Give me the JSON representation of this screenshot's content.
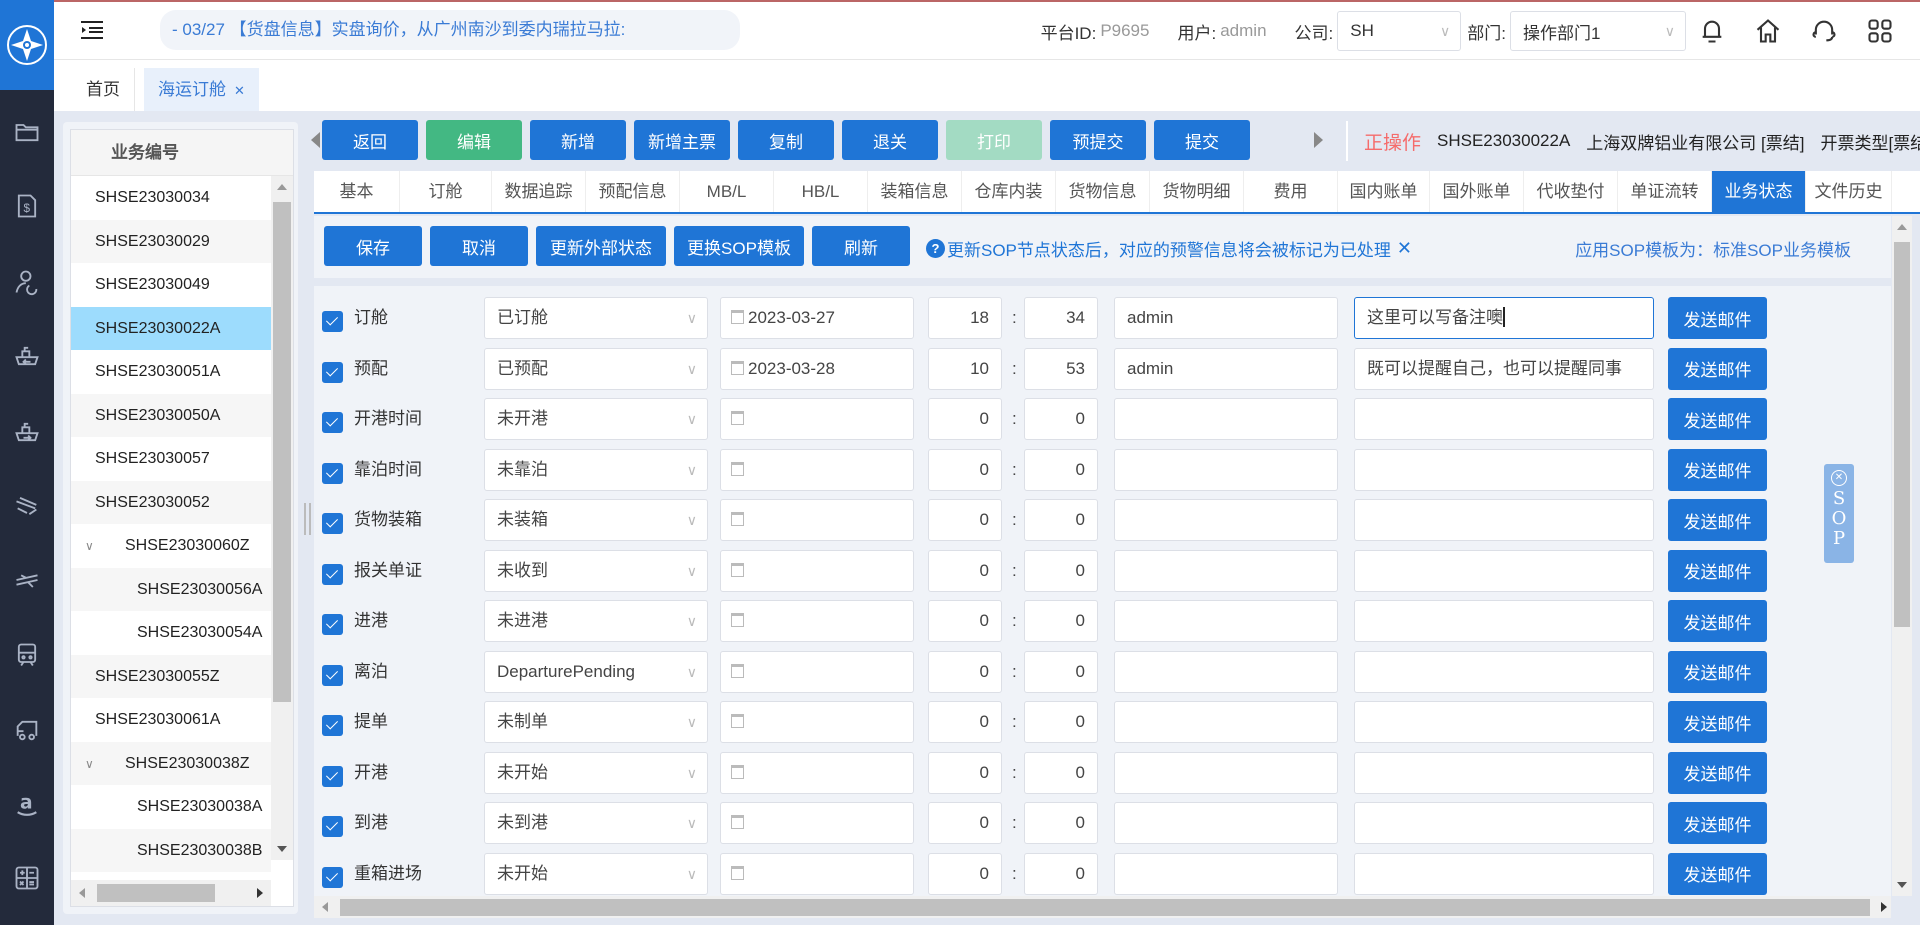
{
  "header": {
    "ticker": "- 03/27  【货盘信息】实盘询价，从广州南沙到委内瑞拉马拉:",
    "platform_id_label": "平台ID:",
    "platform_id": "P9695",
    "user_label": "用户:",
    "user": "admin",
    "company_label": "公司:",
    "company": "SH",
    "dept_label": "部门:",
    "dept": "操作部门1",
    "icons": [
      "bell-icon",
      "home-icon",
      "headset-icon",
      "apps-grid-icon"
    ]
  },
  "page_tabs": [
    {
      "label": "首页"
    },
    {
      "label": "海运订舱",
      "closable": true
    }
  ],
  "nav_icons": [
    "folder-icon",
    "invoice-dollar-icon",
    "user-sync-icon",
    "ship-import-icon",
    "ship-export-icon",
    "flight-icon",
    "air-cargo-icon",
    "train-icon",
    "truck-icon",
    "amazon-icon",
    "calculator-icon"
  ],
  "list": {
    "header": "业务编号",
    "items": [
      {
        "id": "SHSE23030034",
        "level": 0
      },
      {
        "id": "SHSE23030029",
        "level": 0
      },
      {
        "id": "SHSE23030049",
        "level": 0
      },
      {
        "id": "SHSE23030022A",
        "level": 0,
        "selected": true
      },
      {
        "id": "SHSE23030051A",
        "level": 0
      },
      {
        "id": "SHSE23030050A",
        "level": 0
      },
      {
        "id": "SHSE23030057",
        "level": 0
      },
      {
        "id": "SHSE23030052",
        "level": 0
      },
      {
        "id": "SHSE23030060Z",
        "level": 0,
        "expanded": true
      },
      {
        "id": "SHSE23030056A",
        "level": 1
      },
      {
        "id": "SHSE23030054A",
        "level": 1
      },
      {
        "id": "SHSE23030055Z",
        "level": 0
      },
      {
        "id": "SHSE23030061A",
        "level": 0
      },
      {
        "id": "SHSE23030038Z",
        "level": 0,
        "expanded": true
      },
      {
        "id": "SHSE23030038A",
        "level": 1
      },
      {
        "id": "SHSE23030038B",
        "level": 1
      }
    ]
  },
  "actions": {
    "buttons": [
      {
        "label": "返回",
        "style": "primary"
      },
      {
        "label": "编辑",
        "style": "success"
      },
      {
        "label": "新增",
        "style": "primary"
      },
      {
        "label": "新增主票",
        "style": "primary"
      },
      {
        "label": "复制",
        "style": "primary"
      },
      {
        "label": "退关",
        "style": "primary"
      },
      {
        "label": "打印",
        "style": "disabled"
      },
      {
        "label": "预提交",
        "style": "primary"
      },
      {
        "label": "提交",
        "style": "primary"
      }
    ],
    "status": "正操作",
    "business_no": "SHSE23030022A",
    "customer": "上海双牌铝业有限公司 [票结]",
    "invoice_type": "开票类型[票结]"
  },
  "sub_tabs": {
    "items": [
      "基本",
      "订舱",
      "数据追踪",
      "预配信息",
      "MB/L",
      "HB/L",
      "装箱信息",
      "仓库内装",
      "货物信息",
      "货物明细",
      "费用",
      "国内账单",
      "国外账单",
      "代收垫付",
      "单证流转",
      "业务状态",
      "文件历史"
    ],
    "active": "业务状态"
  },
  "sop_toolbar": {
    "buttons": [
      "保存",
      "取消",
      "更新外部状态",
      "更换SOP模板",
      "刷新"
    ],
    "hint": "更新SOP节点状态后，对应的预警信息将会被标记为已处理",
    "template_info": "应用SOP模板为：标准SOP业务模板"
  },
  "sop_rows": [
    {
      "checked": true,
      "label": "订舱",
      "status": "已订舱",
      "date": "2023-03-27",
      "hour": "18",
      "minute": "34",
      "user": "admin",
      "remark": "这里可以写备注噢",
      "focused": true,
      "action": "发送邮件"
    },
    {
      "checked": true,
      "label": "预配",
      "status": "已预配",
      "date": "2023-03-28",
      "hour": "10",
      "minute": "53",
      "user": "admin",
      "remark": "既可以提醒自己，也可以提醒同事",
      "action": "发送邮件"
    },
    {
      "checked": true,
      "label": "开港时间",
      "status": "未开港",
      "date": "",
      "hour": "0",
      "minute": "0",
      "user": "",
      "remark": "",
      "action": "发送邮件"
    },
    {
      "checked": true,
      "label": "靠泊时间",
      "status": "未靠泊",
      "date": "",
      "hour": "0",
      "minute": "0",
      "user": "",
      "remark": "",
      "action": "发送邮件"
    },
    {
      "checked": true,
      "label": "货物装箱",
      "status": "未装箱",
      "date": "",
      "hour": "0",
      "minute": "0",
      "user": "",
      "remark": "",
      "action": "发送邮件"
    },
    {
      "checked": true,
      "label": "报关单证",
      "status": "未收到",
      "date": "",
      "hour": "0",
      "minute": "0",
      "user": "",
      "remark": "",
      "action": "发送邮件"
    },
    {
      "checked": true,
      "label": "进港",
      "status": "未进港",
      "date": "",
      "hour": "0",
      "minute": "0",
      "user": "",
      "remark": "",
      "action": "发送邮件"
    },
    {
      "checked": true,
      "label": "离泊",
      "status": "DeparturePending",
      "date": "",
      "hour": "0",
      "minute": "0",
      "user": "",
      "remark": "",
      "action": "发送邮件"
    },
    {
      "checked": true,
      "label": "提单",
      "status": "未制单",
      "date": "",
      "hour": "0",
      "minute": "0",
      "user": "",
      "remark": "",
      "action": "发送邮件"
    },
    {
      "checked": true,
      "label": "开港",
      "status": "未开始",
      "date": "",
      "hour": "0",
      "minute": "0",
      "user": "",
      "remark": "",
      "action": "发送邮件"
    },
    {
      "checked": true,
      "label": "到港",
      "status": "未到港",
      "date": "",
      "hour": "0",
      "minute": "0",
      "user": "",
      "remark": "",
      "action": "发送邮件"
    },
    {
      "checked": true,
      "label": "重箱进场",
      "status": "未开始",
      "date": "",
      "hour": "0",
      "minute": "0",
      "user": "",
      "remark": "",
      "action": "发送邮件"
    }
  ],
  "sop_float": {
    "label": "SOP"
  },
  "colors": {
    "primary": "#1f75d6",
    "success": "#43b883",
    "danger": "#f56c6c",
    "selected_row": "#9ddcfd"
  }
}
